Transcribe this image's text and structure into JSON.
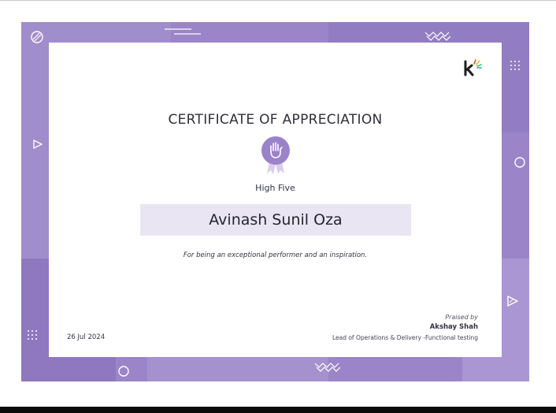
{
  "certificate": {
    "title": "CERTIFICATE OF APPRECIATION",
    "award": "High Five",
    "recipient": "Avinash Sunil Oza",
    "message": "For being an exceptional performer and an inspiration.",
    "date": "26 Jul 2024",
    "praised_label": "Praised by",
    "praiser_name": "Akshay Shah",
    "praiser_role": "Lead of Operations & Delivery -Functional testing"
  },
  "icons": {
    "logo": "brand-k-logo-icon",
    "badge": "high-five-hand-badge-icon"
  },
  "colors": {
    "frame": "#9b85c8",
    "badge": "#9b82c9",
    "name_box": "#e9e5f3",
    "text": "#2f2f3a"
  }
}
